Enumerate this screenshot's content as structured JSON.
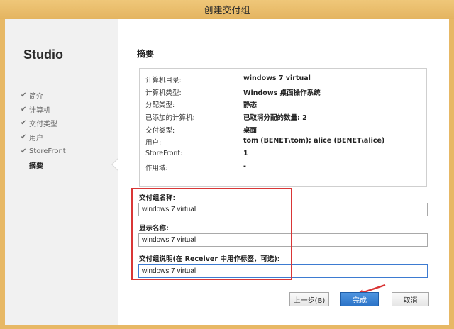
{
  "window": {
    "title": "创建交付组"
  },
  "sidebar": {
    "brand": "Studio",
    "steps": [
      {
        "label": "简介",
        "check": "✔"
      },
      {
        "label": "计算机",
        "check": "✔"
      },
      {
        "label": "交付类型",
        "check": "✔"
      },
      {
        "label": "用户",
        "check": "✔"
      },
      {
        "label": "StoreFront",
        "check": "✔"
      },
      {
        "label": "摘要",
        "check": ""
      }
    ]
  },
  "main": {
    "title": "摘要",
    "summary": [
      {
        "key": "计算机目录:",
        "value": "windows 7 virtual"
      },
      {
        "key": "计算机类型:",
        "value": "Windows 桌面操作系统"
      },
      {
        "key": "分配类型:",
        "value": "静态"
      },
      {
        "key": "已添加的计算机:",
        "value": "已取消分配的数量: 2"
      },
      {
        "key": "交付类型:",
        "value": "桌面"
      },
      {
        "key": "用户:",
        "value": "tom (BENET\\tom); alice (BENET\\alice)"
      },
      {
        "key": "StoreFront:",
        "value": "1"
      },
      {
        "key": "作用域:",
        "value": "-"
      }
    ],
    "fields": {
      "group_name_label": "交付组名称:",
      "group_name_value": "windows 7 virtual",
      "display_name_label": "显示名称:",
      "display_name_value": "windows 7 virtual",
      "description_label": "交付组说明(在 Receiver 中用作标签，可选):",
      "description_value": "windows 7 virtual"
    }
  },
  "buttons": {
    "back": "上一步(B)",
    "finish": "完成",
    "cancel": "取消"
  },
  "colors": {
    "accent": "#2c74c8",
    "highlight": "#d93636",
    "titlebar": "#e7b865"
  }
}
